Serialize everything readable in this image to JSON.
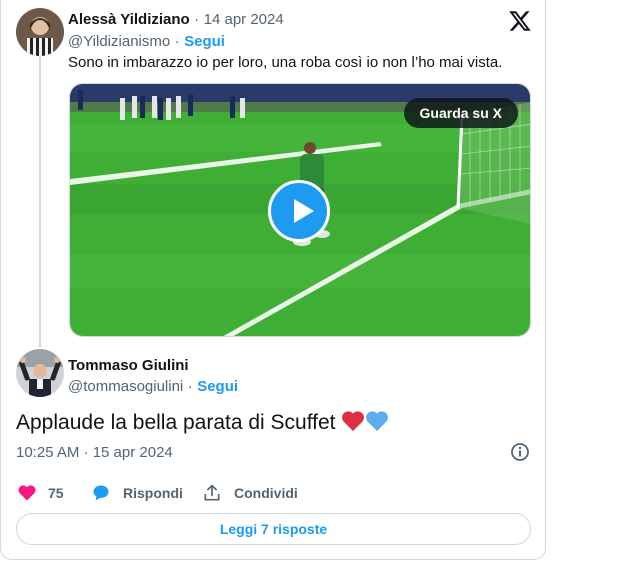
{
  "quoted_tweet": {
    "author_name": "Alessà Yildiziano",
    "date": "14 apr 2024",
    "handle": "@Yildizianismo",
    "follow_label": "Segui",
    "text": "Sono in imbarazzo io per loro, una roba così io non l’ho mai vista.",
    "media": {
      "watch_label": "Guarda su X",
      "play_icon": "play-icon"
    }
  },
  "tweet": {
    "author_name": "Tommaso Giulini",
    "handle": "@tommasogiulini",
    "follow_label": "Segui",
    "text": "Applaude la bella parata di Scuffet",
    "timestamp": "10:25 AM · 15 apr 2024"
  },
  "actions": {
    "like_count": "75",
    "reply_label": "Rispondi",
    "share_label": "Condividi"
  },
  "read_replies_label": "Leggi 7 risposte",
  "colors": {
    "accent": "#1d9bf0",
    "like": "#f91880",
    "muted": "#536471",
    "border": "#cfd9de"
  },
  "separator": "·"
}
